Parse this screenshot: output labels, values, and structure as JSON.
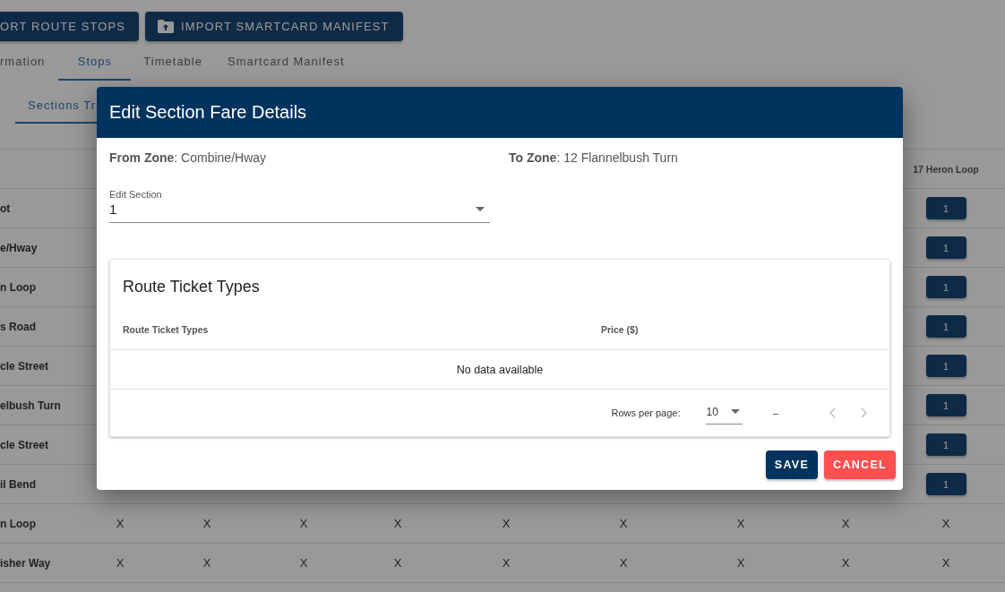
{
  "toolbar": {
    "buttons": [
      {
        "label": "ORT ROUTE STOPS",
        "kind": "plain"
      },
      {
        "label": "IMPORT SMARTCARD MANIFEST",
        "kind": "upload"
      }
    ]
  },
  "tabs": [
    {
      "label": "rmation",
      "selected": false
    },
    {
      "label": "Stops",
      "selected": true
    },
    {
      "label": "Timetable",
      "selected": false
    },
    {
      "label": "Smartcard Manifest",
      "selected": false
    }
  ],
  "subtabs": [
    {
      "label": "Sections Tr",
      "selected": true
    }
  ],
  "fare_table": {
    "columns": [
      "17 Heron Loop"
    ],
    "rows": [
      {
        "label": "ot",
        "cells": [
          {
            "kind": "button",
            "text": "1"
          }
        ]
      },
      {
        "label": "e/Hway",
        "cells": [
          {
            "kind": "button",
            "text": "1"
          }
        ]
      },
      {
        "label": "n Loop",
        "cells": [
          {
            "kind": "button",
            "text": "1"
          }
        ]
      },
      {
        "label": "s Road",
        "cells": [
          {
            "kind": "button",
            "text": "1"
          }
        ]
      },
      {
        "label": "cle Street",
        "cells": [
          {
            "kind": "button",
            "text": "1"
          }
        ]
      },
      {
        "label": "elbush Turn",
        "cells": [
          {
            "kind": "button",
            "text": "1"
          }
        ]
      },
      {
        "label": "cle Street",
        "cells": [
          {
            "kind": "button",
            "text": "1"
          }
        ]
      },
      {
        "label": "il Bend",
        "cells": [
          {
            "kind": "button",
            "text": "1"
          }
        ]
      },
      {
        "label": "n Loop",
        "cells": [
          {
            "kind": "text",
            "text": "X"
          },
          {
            "kind": "text",
            "text": "X"
          },
          {
            "kind": "text",
            "text": "X"
          },
          {
            "kind": "text",
            "text": "X"
          },
          {
            "kind": "text",
            "text": "X"
          },
          {
            "kind": "text",
            "text": "X"
          },
          {
            "kind": "text",
            "text": "X"
          },
          {
            "kind": "text",
            "text": "X"
          },
          {
            "kind": "text",
            "text": "X"
          }
        ]
      },
      {
        "label": "isher Way",
        "cells": [
          {
            "kind": "text",
            "text": "X"
          },
          {
            "kind": "text",
            "text": "X"
          },
          {
            "kind": "text",
            "text": "X"
          },
          {
            "kind": "text",
            "text": "X"
          },
          {
            "kind": "text",
            "text": "X"
          },
          {
            "kind": "text",
            "text": "X"
          },
          {
            "kind": "text",
            "text": "X"
          },
          {
            "kind": "text",
            "text": "X"
          },
          {
            "kind": "text",
            "text": "X"
          }
        ]
      }
    ]
  },
  "dialog": {
    "title": "Edit Section Fare Details",
    "zones": [
      "**From Zone**: Combine/Hway",
      "**To Zone**: 12 Flannelbush Turn"
    ],
    "section_select": {
      "label": "Edit Section",
      "value": "1"
    },
    "ticket_card": {
      "title": "Route Ticket Types",
      "columns": [
        "Route Ticket Types",
        "Price ($)"
      ],
      "empty_text": "No data available",
      "footer": {
        "rows_label": "Rows per page:",
        "rows_value": "10",
        "range": "–",
        "prev_disabled": true,
        "next_disabled": true
      }
    },
    "buttons": [
      {
        "label": "SAVE",
        "kind": "primary"
      },
      {
        "label": "CANCEL",
        "kind": "danger"
      }
    ]
  }
}
